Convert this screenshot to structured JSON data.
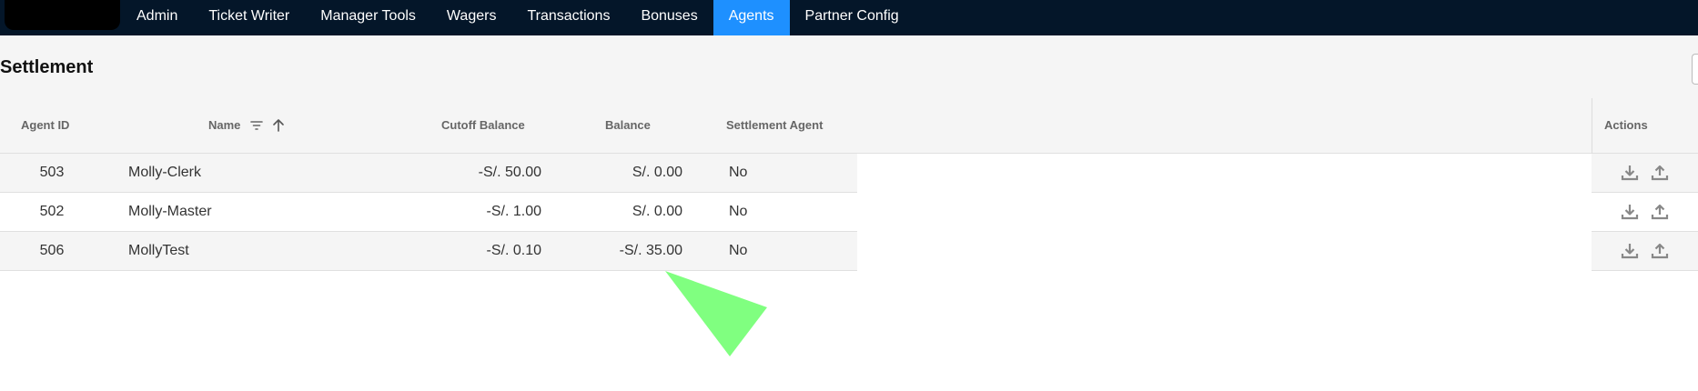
{
  "nav": {
    "items": [
      {
        "label": "Admin",
        "active": false
      },
      {
        "label": "Ticket Writer",
        "active": false
      },
      {
        "label": "Manager Tools",
        "active": false
      },
      {
        "label": "Wagers",
        "active": false
      },
      {
        "label": "Transactions",
        "active": false
      },
      {
        "label": "Bonuses",
        "active": false
      },
      {
        "label": "Agents",
        "active": true
      },
      {
        "label": "Partner Config",
        "active": false
      }
    ],
    "colors": {
      "background": "#041629",
      "active": "#1e90ff"
    }
  },
  "page": {
    "title": "Settlement"
  },
  "table": {
    "columns": {
      "agent_id": "Agent ID",
      "name": "Name",
      "cutoff_balance": "Cutoff Balance",
      "balance": "Balance",
      "settlement_agent": "Settlement Agent",
      "actions": "Actions"
    },
    "rows": [
      {
        "agent_id": "503",
        "name": "Molly-Clerk",
        "cutoff_balance": "-S/. 50.00",
        "balance": "S/. 0.00",
        "settlement_agent": "No"
      },
      {
        "agent_id": "502",
        "name": "Molly-Master",
        "cutoff_balance": "-S/. 1.00",
        "balance": "S/. 0.00",
        "settlement_agent": "No"
      },
      {
        "agent_id": "506",
        "name": "MollyTest",
        "cutoff_balance": "-S/. 0.10",
        "balance": "-S/. 35.00",
        "settlement_agent": "No"
      }
    ],
    "row_actions": [
      "download-icon",
      "upload-icon"
    ],
    "sort": {
      "column": "name",
      "direction": "ascending"
    }
  }
}
